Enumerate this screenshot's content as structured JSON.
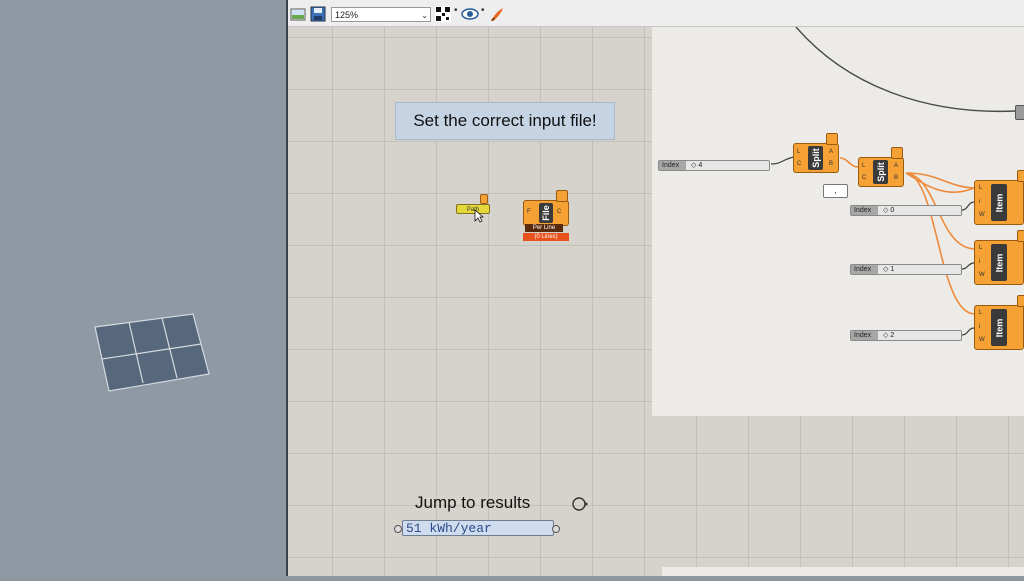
{
  "toolbar": {
    "zoom_value": "125%",
    "icons": [
      "canvas-preview-icon",
      "save-icon",
      "zoom-combo",
      "qr-icon",
      "eye-icon",
      "paint-icon"
    ]
  },
  "canvas": {
    "note_text": "Set the correct input file!",
    "jump_label": "Jump to results",
    "result_value": "51 kWh/year",
    "path_param_label": "Path",
    "file_component_label": "File",
    "file_perline_tag": "Per Line",
    "file_error_tag": "(0 Lines)",
    "small_panel_text": ","
  },
  "components": {
    "split_label": "Split",
    "item_label": "Item",
    "split_ports_in": [
      "L",
      "C"
    ],
    "split_ports_out": [
      "A",
      "B"
    ],
    "item_ports_in": [
      "L",
      "i",
      "W"
    ],
    "sliders": [
      {
        "label": "Index",
        "value": "4"
      },
      {
        "label": "Index",
        "value": "0"
      },
      {
        "label": "Index",
        "value": "1"
      },
      {
        "label": "Index",
        "value": "2"
      }
    ]
  },
  "colors": {
    "component_orange": "#f6a134",
    "wire_orange": "#ee8a3a",
    "error_red": "#e8501c",
    "note_blue": "#c5d3e3",
    "canvas_bg": "#d6d3cc",
    "group_bg": "#ecebe7",
    "viewport_bg": "#8f99a3"
  }
}
